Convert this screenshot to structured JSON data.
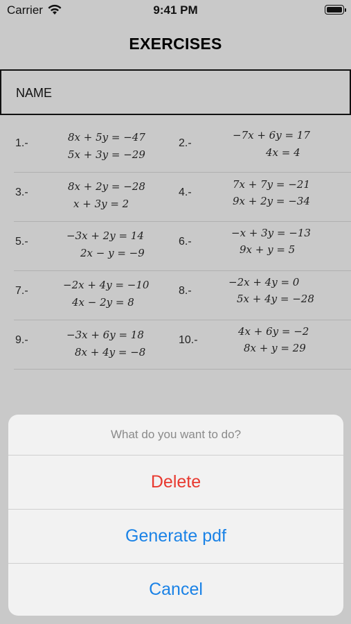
{
  "status_bar": {
    "carrier": "Carrier",
    "time": "9:41 PM"
  },
  "header": {
    "title": "EXERCISES"
  },
  "name_field": {
    "label": "NAME"
  },
  "exercises": [
    {
      "number": "1.-",
      "eq1": "8x + 5y = −47",
      "eq2": "5x + 3y = −29"
    },
    {
      "number": "2.-",
      "eq1": "−7x + 6y = 17",
      "eq2": "4x = 4"
    },
    {
      "number": "3.-",
      "eq1": "8x + 2y = −28",
      "eq2": "x + 3y = 2"
    },
    {
      "number": "4.-",
      "eq1": "7x + 7y = −21",
      "eq2": "9x + 2y = −34"
    },
    {
      "number": "5.-",
      "eq1": "−3x + 2y = 14",
      "eq2": "2x − y = −9"
    },
    {
      "number": "6.-",
      "eq1": "−x + 3y = −13",
      "eq2": "9x + y = 5"
    },
    {
      "number": "7.-",
      "eq1": "−2x + 4y = −10",
      "eq2": "4x − 2y = 8"
    },
    {
      "number": "8.-",
      "eq1": "−2x + 4y = 0",
      "eq2": "5x + 4y = −28"
    },
    {
      "number": "9.-",
      "eq1": "−3x + 6y = 18",
      "eq2": "8x + 4y = −8"
    },
    {
      "number": "10.-",
      "eq1": "4x + 6y = −2",
      "eq2": "8x + y = 29"
    }
  ],
  "action_sheet": {
    "title": "What do you want to do?",
    "delete_label": "Delete",
    "generate_pdf_label": "Generate pdf",
    "cancel_label": "Cancel",
    "delete_color": "#e8392f",
    "action_color": "#1a82e6"
  }
}
